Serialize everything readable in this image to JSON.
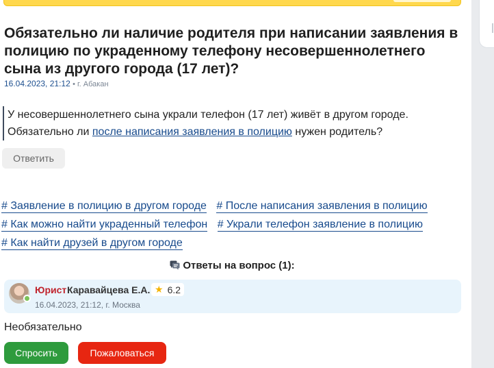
{
  "question": {
    "title": "Обязательно ли наличие родителя при написании заявления в полицию по украденному телефону несовершеннолетнего сына из другого города (17 лет)?",
    "date": "16.04.2023, 21:12",
    "city": "• г. Абакан",
    "body_part1": "У несовершеннолетнего сына украли телефон (17 лет) живёт в другом городе. Обязательно ли ",
    "body_link": "после написания заявления в полицию",
    "body_part2": " нужен родитель?",
    "reply_label": "Ответить"
  },
  "tags": [
    "# Заявление в полицию в другом городе",
    "# После написания заявления в полицию",
    "# Как можно найти украденный телефон",
    "# Украли телефон заявление в полицию",
    "# Как найти друзей в другом городе"
  ],
  "answers": {
    "heading": "Ответы на вопрос (1):",
    "items": [
      {
        "role": "Юрист",
        "name": "Каравайцева Е.А.",
        "rating": "6.2",
        "meta": "16.04.2023, 21:12, г. Москва",
        "text": "Необязательно"
      }
    ]
  },
  "actions": {
    "ask_label": "Спросить",
    "report_label": "Пожаловаться"
  },
  "colors": {
    "link": "#174a8c",
    "role": "#c0232c",
    "ask": "#2e9b3d",
    "report": "#e72611",
    "answer_bg": "#e8f4fc"
  },
  "icons": {
    "answers_heading": "chat-bubbles-icon",
    "rating": "star-icon",
    "presence": "online-status-icon"
  }
}
